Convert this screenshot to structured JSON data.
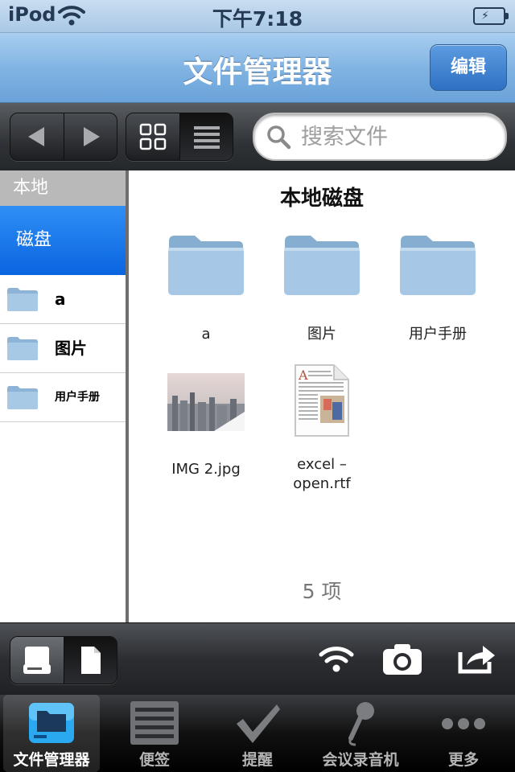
{
  "status_bar": {
    "carrier": "iPod",
    "time": "下午7:18"
  },
  "nav": {
    "title": "文件管理器",
    "edit_label": "编辑"
  },
  "toolbar": {
    "search_placeholder": "搜索文件"
  },
  "sidebar": {
    "header": "本地",
    "disk_label": "磁盘",
    "items": [
      {
        "label": "a"
      },
      {
        "label": "图片"
      },
      {
        "label": "用户手册"
      }
    ]
  },
  "main": {
    "heading": "本地磁盘",
    "items": [
      {
        "label": "a",
        "icon": "folder-icon"
      },
      {
        "label": "图片",
        "icon": "folder-icon"
      },
      {
        "label": "用户手册",
        "icon": "folder-icon"
      },
      {
        "label": "IMG 2.jpg",
        "icon": "image-thumbnail"
      },
      {
        "label": "excel –\nopen.rtf",
        "icon": "document-icon"
      }
    ],
    "count": "5 项"
  },
  "bottom_toolbar": {
    "icons": [
      "local-disk-icon",
      "document-icon",
      "wifi-icon",
      "camera-icon",
      "share-icon"
    ]
  },
  "tabs": [
    {
      "label": "文件管理器",
      "icon": "file-manager-icon",
      "active": true
    },
    {
      "label": "便签",
      "icon": "notes-icon",
      "active": false
    },
    {
      "label": "提醒",
      "icon": "checkmark-icon",
      "active": false
    },
    {
      "label": "会议录音机",
      "icon": "microphone-icon",
      "active": false
    },
    {
      "label": "更多",
      "icon": "more-icon",
      "active": false
    }
  ],
  "colors": {
    "nav_blue": "#7eb2e2",
    "selected_blue": "#1a74e8",
    "sidebar_header": "#b9b9b9"
  }
}
